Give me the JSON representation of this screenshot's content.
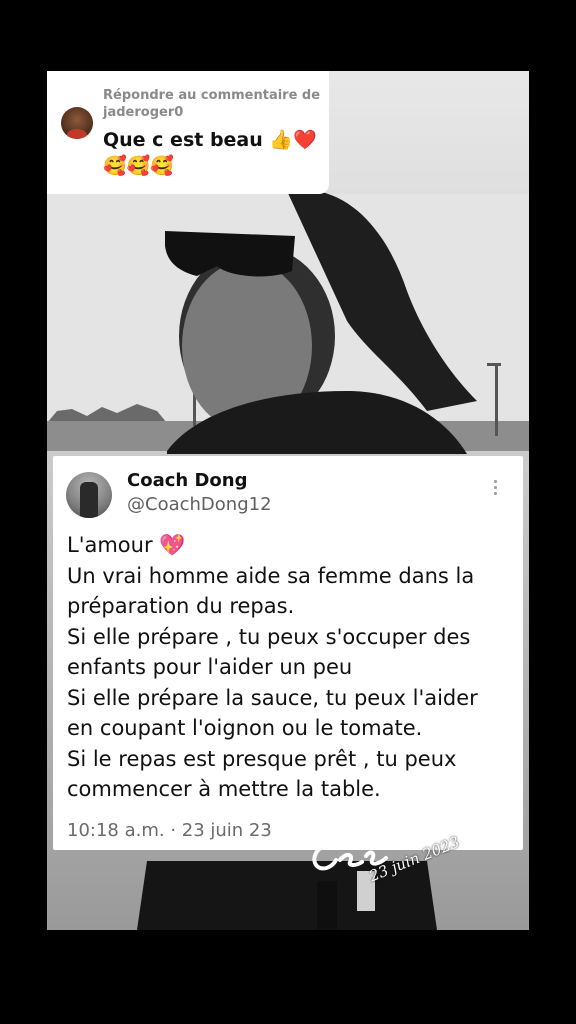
{
  "reply": {
    "label": "Répondre au commentaire de jaderoger0",
    "comment_text": "Que c est beau 👍❤️",
    "comment_emojis": "🥰🥰🥰"
  },
  "tweet": {
    "name": "Coach Dong",
    "handle": "@CoachDong12",
    "lines": [
      "L'amour 💖",
      "Un vrai homme aide sa femme dans la",
      "préparation du repas.",
      "Si elle prépare , tu peux s'occuper des",
      "enfants pour l'aider un peu",
      "Si elle prépare la sauce, tu peux l'aider",
      "en coupant l'oignon ou le tomate.",
      "Si le repas est presque prêt , tu peux",
      "commencer à mettre la table."
    ],
    "timestamp": "10:18 a.m. · 23 juin 23"
  },
  "watermark": {
    "date": "23 juin 2023"
  }
}
